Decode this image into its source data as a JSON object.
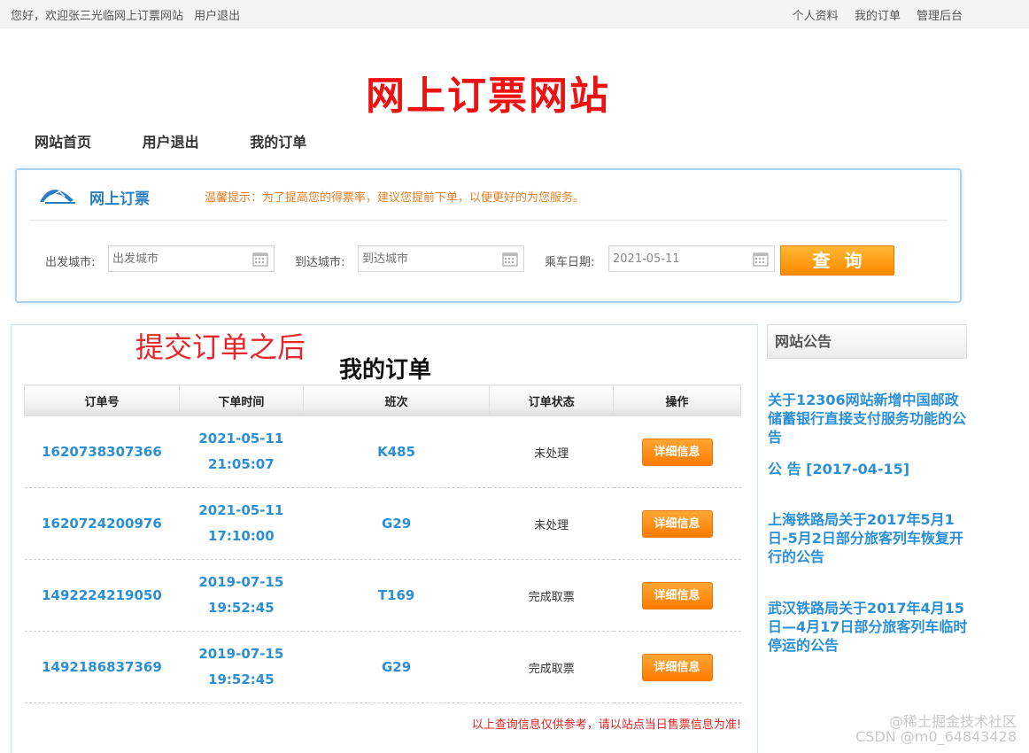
{
  "topbar": {
    "greeting": "您好，欢迎张三光临网上订票网站",
    "logout": "用户退出",
    "links": [
      "个人资料",
      "我的订单",
      "管理后台"
    ]
  },
  "site_title": "网上订票网站",
  "nav": [
    "网站首页",
    "用户退出",
    "我的订单"
  ],
  "search": {
    "title": "网上订票",
    "tip": "温馨提示：为了提高您的得票率，建议您提前下单，以便更好的为您服务。",
    "from_label": "出发城市:",
    "from_placeholder": "出发城市",
    "to_label": "到达城市:",
    "to_placeholder": "到达城市",
    "date_label": "乘车日期:",
    "date_value": "2021-05-11",
    "query_button": "查询"
  },
  "orders": {
    "note": "提交订单之后",
    "heading": "我的订单",
    "columns": [
      "订单号",
      "下单时间",
      "班次",
      "订单状态",
      "操作"
    ],
    "rows": [
      {
        "id": "1620738307366",
        "date": "2021-05-11",
        "time": "21:05:07",
        "train": "K485",
        "status": "未处理",
        "action": "详细信息"
      },
      {
        "id": "1620724200976",
        "date": "2021-05-11",
        "time": "17:10:00",
        "train": "G29",
        "status": "未处理",
        "action": "详细信息"
      },
      {
        "id": "1492224219050",
        "date": "2019-07-15",
        "time": "19:52:45",
        "train": "T169",
        "status": "完成取票",
        "action": "详细信息"
      },
      {
        "id": "1492186837369",
        "date": "2019-07-15",
        "time": "19:52:45",
        "train": "G29",
        "status": "完成取票",
        "action": "详细信息"
      }
    ],
    "disclaimer": "以上查询信息仅供参考，请以站点当日售票信息为准!"
  },
  "notices": {
    "title": "网站公告",
    "items": [
      "关于12306网站新增中国邮政储蓄银行直接支付服务功能的公告",
      "公 告 [2017-04-15]",
      "上海铁路局关于2017年5月1日-5月2日部分旅客列车恢复开行的公告",
      "武汉铁路局关于2017年4月15日—4月17日部分旅客列车临时停运的公告"
    ]
  },
  "watermark": {
    "line1": "@稀土掘金技术社区",
    "line2": "CSDN @m0_64843428"
  },
  "colors": {
    "title_red": "#ee1111",
    "link_blue": "#2b8fd6",
    "button_orange": "#ff8a00",
    "tip_orange": "#e67e22"
  }
}
